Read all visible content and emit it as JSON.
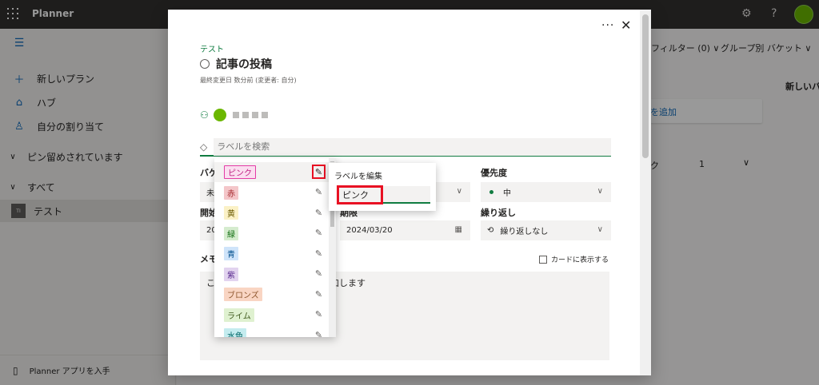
{
  "app": {
    "name": "Planner"
  },
  "topbar": {
    "settings_icon": "gear-icon",
    "help_icon": "question-icon",
    "help_glyph": "?"
  },
  "nav": {
    "collapse_icon": "hamburger-icon",
    "items": [
      {
        "label": "新しいプラン",
        "icon": "plus-icon"
      },
      {
        "label": "ハブ",
        "icon": "home-icon"
      },
      {
        "label": "自分の割り当て",
        "icon": "person-icon"
      }
    ],
    "pinned_section": "ピン留めされています",
    "all_section": "すべて",
    "plan": {
      "tile": "TI",
      "label": "テスト"
    },
    "footer": "Planner アプリを入手"
  },
  "background": {
    "filter_label": "フィルター (0)",
    "group_label": "グループ別 バケット",
    "new_bucket": "新しいバ",
    "add_task": "を追加",
    "count_label": "ク",
    "count_value": "1"
  },
  "dialog": {
    "plan_name": "テスト",
    "task_title": "記事の投稿",
    "last_modified": "最終変更日 数分前 (変更者: 自分)",
    "label_search_placeholder": "ラベルを検索",
    "bucket_label": "バケ",
    "bucket_value": "未",
    "start_label": "開始",
    "start_value": "20",
    "due_label": "期限",
    "due_value": "2024/03/20",
    "priority_label": "優先度",
    "priority_value": "中",
    "repeat_label": "繰り返し",
    "repeat_value": "繰り返しなし",
    "notes_label": "メモ",
    "show_on_card": "カードに表示する",
    "notes_prefix": "こ",
    "notes_suffix": "追加します"
  },
  "label_dropdown": {
    "items": [
      {
        "name": "ピンク",
        "bg": "#fbdef0",
        "border": "#e43ba6",
        "fg": "#c02384"
      },
      {
        "name": "赤",
        "bg": "#f4c6c9",
        "border": "",
        "fg": "#a4262c"
      },
      {
        "name": "黄",
        "bg": "#fbf1c6",
        "border": "",
        "fg": "#6b5a00"
      },
      {
        "name": "緑",
        "bg": "#d5ecce",
        "border": "",
        "fg": "#0b6a0b"
      },
      {
        "name": "青",
        "bg": "#cfe4fa",
        "border": "",
        "fg": "#004e8c"
      },
      {
        "name": "紫",
        "bg": "#e2d3ef",
        "border": "",
        "fg": "#5c2e91"
      },
      {
        "name": "ブロンズ",
        "bg": "#f9d5c3",
        "border": "",
        "fg": "#8e562e"
      },
      {
        "name": "ライム",
        "bg": "#dff1d0",
        "border": "",
        "fg": "#405b1e"
      },
      {
        "name": "水色",
        "bg": "#c4ecef",
        "border": "",
        "fg": "#006666"
      }
    ]
  },
  "edit_flyout": {
    "title": "ラベルを編集",
    "value": "ピンク"
  }
}
